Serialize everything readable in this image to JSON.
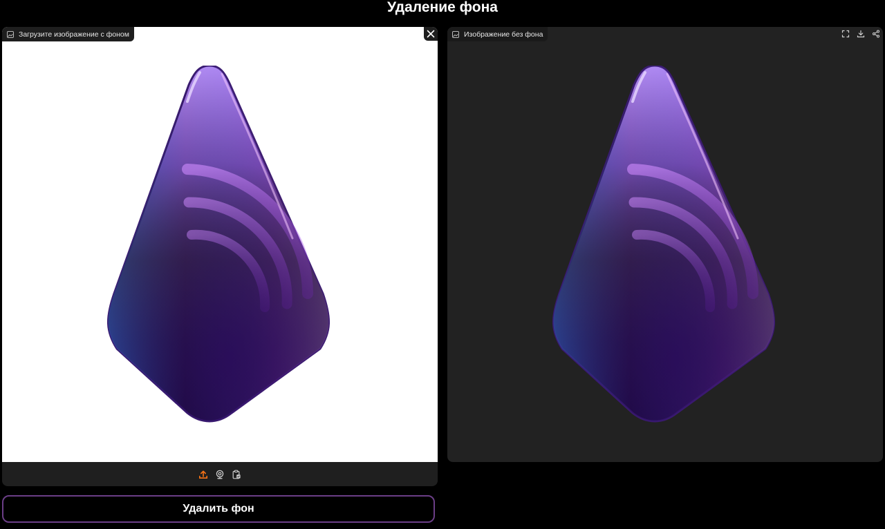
{
  "header": {
    "title": "Удаление фона"
  },
  "input_panel": {
    "label": "Загрузите изображение с фоном",
    "label_icon": "image-icon",
    "close_icon": "close-icon",
    "background_color": "#ffffff",
    "sources": [
      {
        "name": "upload-icon",
        "color": "#f97316"
      },
      {
        "name": "webcam-icon",
        "color": "#cfcfcf"
      },
      {
        "name": "clipboard-icon",
        "color": "#cfcfcf"
      }
    ]
  },
  "output_panel": {
    "label": "Изображение без фона",
    "label_icon": "image-icon",
    "background_color": "#222222",
    "actions": [
      "fullscreen-icon",
      "download-icon",
      "share-icon"
    ]
  },
  "image": {
    "subject": "purple-gem-logo"
  },
  "run_button": {
    "label": "Удалить фон",
    "border_color": "#6b3e87"
  }
}
